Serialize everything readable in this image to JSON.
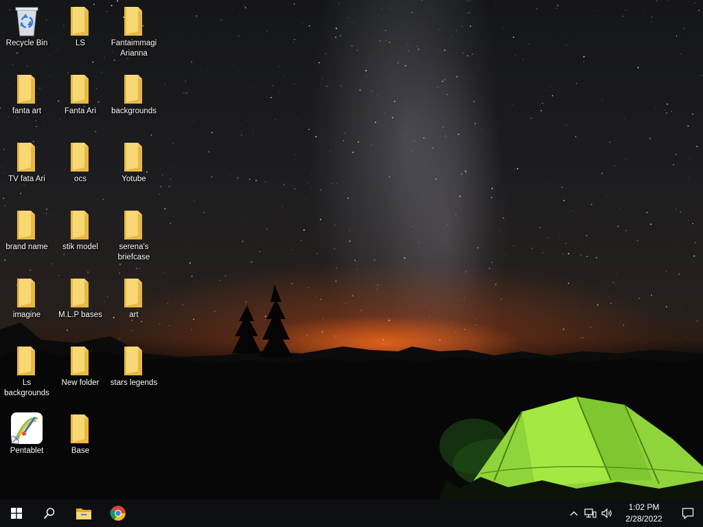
{
  "desktop": {
    "icons": [
      {
        "name": "recycle-bin",
        "type": "recycle-bin",
        "label": "Recycle Bin"
      },
      {
        "name": "folder-ls",
        "type": "folder",
        "label": "LS"
      },
      {
        "name": "folder-fantaimmagi-arianna",
        "type": "folder",
        "label": "Fantaimmagi Arianna"
      },
      {
        "name": "folder-fanta-art",
        "type": "folder",
        "label": "fanta art"
      },
      {
        "name": "folder-fanta-ari",
        "type": "folder",
        "label": "Fanta Ari"
      },
      {
        "name": "folder-backgrounds",
        "type": "folder",
        "label": "backgrounds"
      },
      {
        "name": "folder-tv-fata-ari",
        "type": "folder",
        "label": "TV  fata Ari"
      },
      {
        "name": "folder-ocs",
        "type": "folder",
        "label": "ocs"
      },
      {
        "name": "folder-yotube",
        "type": "folder",
        "label": "Yotube"
      },
      {
        "name": "folder-brand-name",
        "type": "folder",
        "label": "brand name"
      },
      {
        "name": "folder-stik-model",
        "type": "folder",
        "label": "stik  model"
      },
      {
        "name": "folder-serenas-briefcase",
        "type": "folder",
        "label": "serena's briefcase"
      },
      {
        "name": "folder-imagine",
        "type": "folder",
        "label": "imagine"
      },
      {
        "name": "folder-mlp-bases",
        "type": "folder",
        "label": "M.L.P bases"
      },
      {
        "name": "folder-art",
        "type": "folder",
        "label": "art"
      },
      {
        "name": "folder-ls-backgrounds",
        "type": "folder",
        "label": "Ls backgrounds"
      },
      {
        "name": "folder-new-folder",
        "type": "folder",
        "label": "New folder"
      },
      {
        "name": "folder-stars-legends",
        "type": "folder",
        "label": "stars legends"
      },
      {
        "name": "pentablet-shortcut",
        "type": "app-shortcut",
        "label": "Pentablet"
      },
      {
        "name": "folder-base",
        "type": "folder",
        "label": "Base"
      }
    ]
  },
  "taskbar": {
    "start_icon": "windows-logo-icon",
    "search_icon": "search-icon",
    "pinned": [
      {
        "name": "file-explorer-icon",
        "label": "File Explorer"
      },
      {
        "name": "chrome-icon",
        "label": "Google Chrome"
      }
    ],
    "tray_icons": [
      "chevron-up-icon",
      "network-icon",
      "volume-icon"
    ],
    "clock": {
      "time": "1:02 PM",
      "date": "2/28/2022"
    },
    "notification_icon": "notification-icon"
  },
  "colors": {
    "taskbar_bg": "#0d0f12",
    "folder_yellow": "#f8d775",
    "folder_shade": "#e8b843",
    "tent_green": "#9be23a"
  }
}
